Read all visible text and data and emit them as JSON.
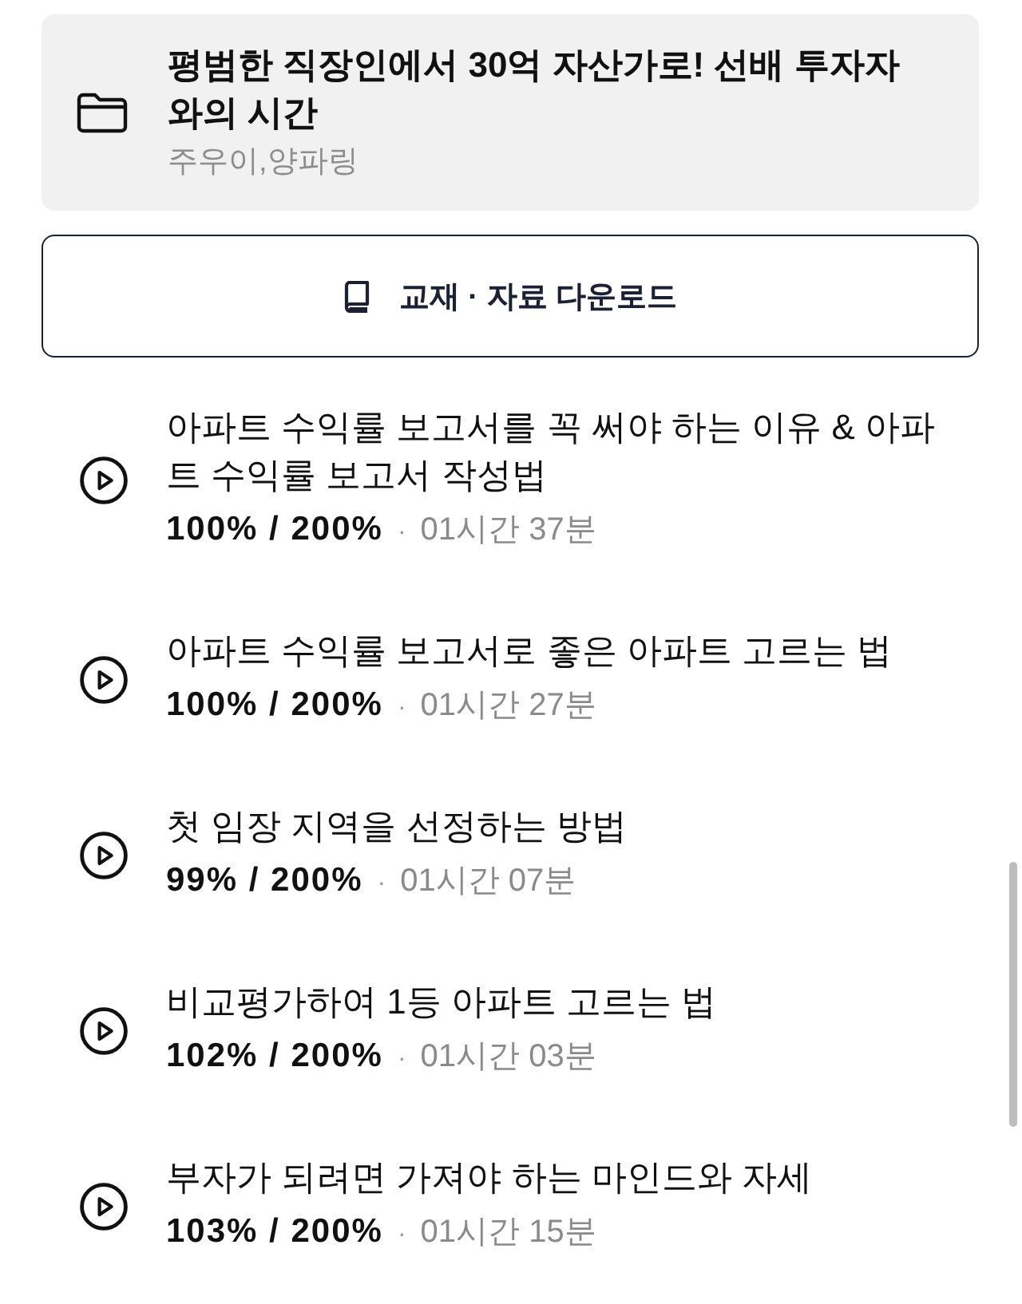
{
  "course": {
    "title": "평범한 직장인에서 30억 자산가로! 선배 투자자와의 시간",
    "instructors": "주우이,양파링"
  },
  "download_button": {
    "label": "교재 · 자료 다운로드"
  },
  "lessons": [
    {
      "title": "아파트 수익률 보고서를 꼭 써야 하는 이유 & 아파트 수익률 보고서 작성법",
      "progress": "100% / 200%",
      "separator": "·",
      "duration": "01시간 37분"
    },
    {
      "title": "아파트 수익률 보고서로 좋은 아파트 고르는 법",
      "progress": "100% / 200%",
      "separator": "·",
      "duration": "01시간 27분"
    },
    {
      "title": "첫 임장 지역을 선정하는 방법",
      "progress": "99% / 200%",
      "separator": "·",
      "duration": "01시간 07분"
    },
    {
      "title": "비교평가하여 1등 아파트 고르는 법",
      "progress": "102% / 200%",
      "separator": "·",
      "duration": "01시간 03분"
    },
    {
      "title": "부자가 되려면 가져야 하는 마인드와 자세",
      "progress": "103% / 200%",
      "separator": "·",
      "duration": "01시간 15분"
    }
  ]
}
